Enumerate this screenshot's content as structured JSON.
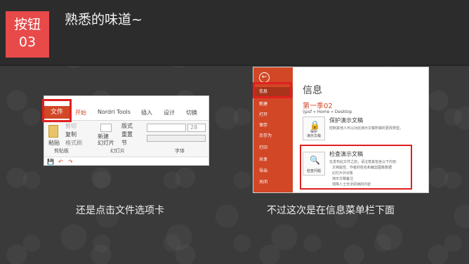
{
  "header": {
    "badge_line1": "按钮",
    "badge_line2": "03",
    "title": "熟悉的味道~"
  },
  "left_shot": {
    "tabs": [
      "文件",
      "开始",
      "Nordri Tools",
      "插入",
      "设计",
      "切换"
    ],
    "clipboard": {
      "paste": "粘贴",
      "cut": "剪切",
      "copy": "复制",
      "format_painter": "格式刷",
      "group": "剪贴板"
    },
    "slides": {
      "new_slide": "新建\n幻灯片",
      "layout": "版式",
      "reset": "重置",
      "section": "节",
      "group": "幻灯片"
    },
    "font": {
      "size": "28",
      "group": "字体"
    },
    "quick_access": [
      "💾",
      "↶",
      "↷"
    ]
  },
  "right_shot": {
    "menu": [
      "信息",
      "新建",
      "打开",
      "保存",
      "另存为",
      "打印",
      "共享",
      "导出",
      "关闭"
    ],
    "title": "信息",
    "doc_name": "第一季02",
    "path": "\\\\psf » Home » Desktop",
    "protect": {
      "button": "保护\n演示文稿",
      "heading": "保护演示文稿",
      "desc": "控制其他人可以对此演示文稿所做的更改类型。"
    },
    "inspect": {
      "button": "检查问题",
      "heading": "检查演示文稿",
      "desc": "在发布此文件之前，请注意其包含以下内容:",
      "bullets": [
        "文档属性、作者的姓名和裁剪图像数据",
        "幻灯片外对象",
        "演示文稿备注",
        "残障人士无法阅读的内容"
      ]
    }
  },
  "captions": {
    "left": "还是点击文件选项卡",
    "right": "不过这次是在信息菜单栏下面"
  },
  "colors": {
    "accent": "#e84a4a",
    "office_orange": "#d24726",
    "highlight": "#e02020",
    "background": "#3a3a3a"
  }
}
